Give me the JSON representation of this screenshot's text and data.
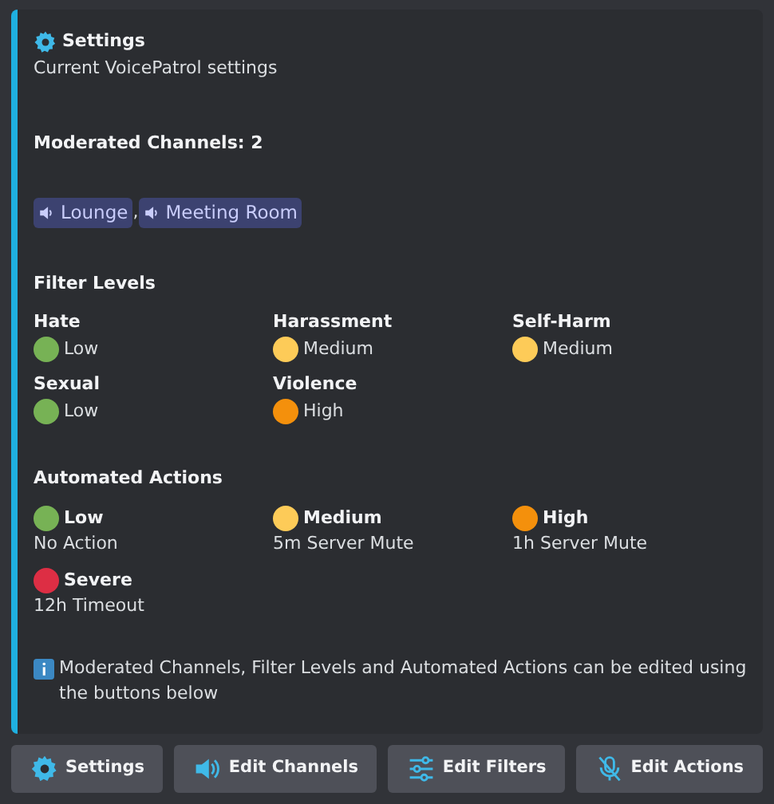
{
  "embed": {
    "title": "Settings",
    "description": "Current VoicePatrol settings",
    "channels_heading": "Moderated Channels: 2",
    "channels": [
      "Lounge",
      "Meeting Room"
    ],
    "separator": ",",
    "filter_heading": "Filter Levels",
    "filters": [
      {
        "name": "Hate",
        "level": "Low",
        "color": "#77b255"
      },
      {
        "name": "Harassment",
        "level": "Medium",
        "color": "#fdcb58"
      },
      {
        "name": "Self-Harm",
        "level": "Medium",
        "color": "#fdcb58"
      },
      {
        "name": "Sexual",
        "level": "Low",
        "color": "#77b255"
      },
      {
        "name": "Violence",
        "level": "High",
        "color": "#f4900c"
      }
    ],
    "actions_heading": "Automated Actions",
    "actions": [
      {
        "level": "Low",
        "action": "No Action",
        "color": "#77b255"
      },
      {
        "level": "Medium",
        "action": "5m Server Mute",
        "color": "#fdcb58"
      },
      {
        "level": "High",
        "action": "1h Server Mute",
        "color": "#f4900c"
      },
      {
        "level": "Severe",
        "action": "12h Timeout",
        "color": "#dd2e44"
      }
    ],
    "note": "Moderated Channels, Filter Levels and Automated Actions can be edited using the buttons below"
  },
  "buttons": [
    {
      "label": "Settings",
      "kind": "gear"
    },
    {
      "label": "Edit Channels",
      "kind": "speaker"
    },
    {
      "label": "Edit Filters",
      "kind": "sliders"
    },
    {
      "label": "Edit Actions",
      "kind": "mute"
    }
  ]
}
